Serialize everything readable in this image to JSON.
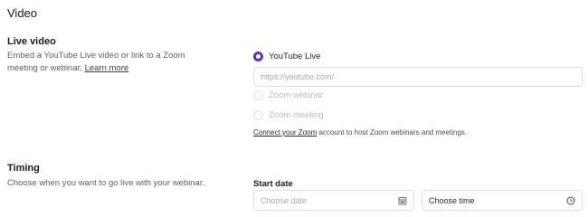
{
  "section": {
    "title": "Video"
  },
  "live_video": {
    "title": "Live video",
    "description": "Embed a YouTube Live video or link to a Zoom meeting or webinar.",
    "learn_more": "Learn more",
    "options": [
      {
        "label": "YouTube Live",
        "selected": true,
        "disabled": false
      },
      {
        "label": "Zoom webinar",
        "selected": false,
        "disabled": true
      },
      {
        "label": "Zoom meeting",
        "selected": false,
        "disabled": true
      }
    ],
    "url_input": {
      "placeholder": "https://youtube.com/",
      "value": ""
    },
    "connect_note": {
      "link": "Connect your Zoom",
      "text": " account to host Zoom webinars and meetings."
    }
  },
  "timing": {
    "title": "Timing",
    "description": "Choose when you want to go live with your webinar.",
    "start_date_label": "Start date",
    "date_input": {
      "placeholder": "Choose date",
      "icon": "calendar-icon"
    },
    "time_input": {
      "value": "Choose time",
      "icon": "clock-icon"
    }
  },
  "colors": {
    "accent": "#5b2fd1",
    "border": "#dcdee2",
    "muted_text": "#5b5f66",
    "disabled_text": "#b8bbc0"
  }
}
